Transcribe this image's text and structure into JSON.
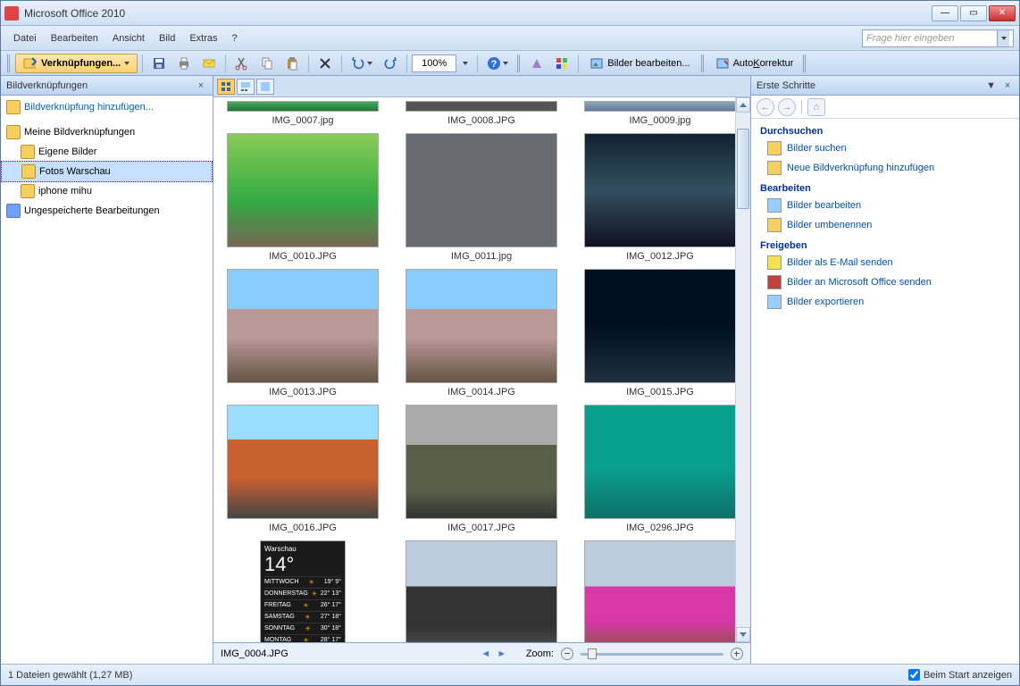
{
  "window": {
    "title": "Microsoft Office 2010"
  },
  "menu": {
    "items": [
      "Datei",
      "Bearbeiten",
      "Ansicht",
      "Bild",
      "Extras",
      "?"
    ]
  },
  "helpbox_placeholder": "Frage hier eingeben",
  "toolbar": {
    "links_btn": "Verknüpfungen...",
    "zoom": "100%",
    "edit_images": "Bilder bearbeiten...",
    "autokorrektur": "AutoKorrektur"
  },
  "left_pane": {
    "title": "Bildverknüpfungen",
    "add_link": "Bildverknüpfung hinzufügen...",
    "tree": {
      "root": "Meine Bildverknüpfungen",
      "children": [
        "Eigene Bilder",
        "Fotos Warschau",
        "iphone mihu"
      ],
      "unsaved": "Ungespeicherte Bearbeitungen"
    }
  },
  "thumbnails": [
    {
      "file": "IMG_0007.jpg",
      "partial": true,
      "bg": "linear-gradient(#4a6, #273)"
    },
    {
      "file": "IMG_0008.JPG",
      "partial": true,
      "bg": "#555"
    },
    {
      "file": "IMG_0009.jpg",
      "partial": true,
      "bg": "linear-gradient(#8ab,#679)"
    },
    {
      "file": "IMG_0010.JPG",
      "bg": "linear-gradient(#8c5,#3a4 60%,#765)"
    },
    {
      "file": "IMG_0011.jpg",
      "bg": "#6a6a72"
    },
    {
      "file": "IMG_0012.JPG",
      "bg": "linear-gradient(#123,#335060 50%,#112)"
    },
    {
      "file": "IMG_0013.JPG",
      "bg": "linear-gradient(#8cf 0 35%,#b99 35% 60%,#654)"
    },
    {
      "file": "IMG_0014.JPG",
      "bg": "linear-gradient(#8cf 0 35%,#b99 35% 60%,#654)"
    },
    {
      "file": "IMG_0015.JPG",
      "bg": "linear-gradient(#001020 0 50%,#203040)"
    },
    {
      "file": "IMG_0016.JPG",
      "bg": "linear-gradient(#9df 0 30%,#c96030 30% 65%,#444)"
    },
    {
      "file": "IMG_0017.JPG",
      "bg": "linear-gradient(#aaa 0 35%,#586048 35% 75%,#333)"
    },
    {
      "file": "IMG_0296.JPG",
      "bg": "linear-gradient(#0aa090 0 55%,#0e7068)"
    },
    {
      "file": "IMG_0004.JPG",
      "bg": "linear-gradient(#111,#222)",
      "weather": true
    },
    {
      "file": "",
      "bg": "linear-gradient(#bcd 0 40%,#333 40% 75%,#555)"
    },
    {
      "file": "",
      "bg": "linear-gradient(#bcd 0 40%,#d838a8 40% 70%,#854)"
    }
  ],
  "weather_widget": {
    "city": "Warschau",
    "temp": "14°",
    "rows": [
      {
        "day": "MITTWOCH",
        "hi": "19°",
        "lo": "9°"
      },
      {
        "day": "DONNERSTAG",
        "hi": "22°",
        "lo": "13°"
      },
      {
        "day": "FREITAG",
        "hi": "26°",
        "lo": "17°"
      },
      {
        "day": "SAMSTAG",
        "hi": "27°",
        "lo": "18°"
      },
      {
        "day": "SONNTAG",
        "hi": "30°",
        "lo": "18°"
      },
      {
        "day": "MONTAG",
        "hi": "28°",
        "lo": "17°"
      }
    ]
  },
  "main_status": {
    "filename": "IMG_0004.JPG",
    "zoom_label": "Zoom:"
  },
  "right_pane": {
    "title": "Erste Schritte",
    "sections": [
      {
        "title": "Durchsuchen",
        "links": [
          {
            "icon": "search",
            "text": "Bilder suchen"
          },
          {
            "icon": "folder",
            "text": "Neue Bildverknüpfung hinzufügen"
          }
        ]
      },
      {
        "title": "Bearbeiten",
        "links": [
          {
            "icon": "edit",
            "text": "Bilder bearbeiten"
          },
          {
            "icon": "rename",
            "text": "Bilder umbenennen"
          }
        ]
      },
      {
        "title": "Freigeben",
        "links": [
          {
            "icon": "mail",
            "text": "Bilder als E-Mail senden"
          },
          {
            "icon": "office",
            "text": "Bilder an Microsoft Office senden"
          },
          {
            "icon": "export",
            "text": "Bilder exportieren"
          }
        ]
      }
    ]
  },
  "statusbar": {
    "text": "1 Dateien gewählt (1,27 MB)",
    "checkbox": "Beim Start anzeigen"
  }
}
